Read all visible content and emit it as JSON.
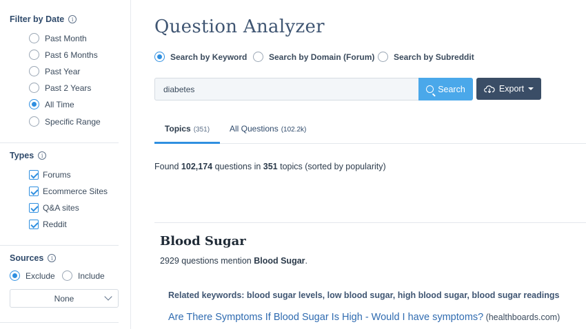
{
  "sidebar": {
    "filter_by_date": {
      "title": "Filter by Date",
      "options": [
        "Past Month",
        "Past 6 Months",
        "Past Year",
        "Past 2 Years",
        "All Time",
        "Specific Range"
      ],
      "selected": "All Time"
    },
    "types": {
      "title": "Types",
      "options": [
        "Forums",
        "Ecommerce Sites",
        "Q&A sites",
        "Reddit"
      ],
      "checked": [
        true,
        true,
        true,
        true
      ]
    },
    "sources": {
      "title": "Sources",
      "exclude_label": "Exclude",
      "include_label": "Include",
      "selected": "Exclude",
      "select_value": "None"
    }
  },
  "main": {
    "title": "Question Analyzer",
    "search_modes": [
      "Search by Keyword",
      "Search by Domain (Forum)",
      "Search by Subreddit"
    ],
    "selected_mode": "Search by Keyword",
    "search_value": "diabetes",
    "search_button": "Search",
    "export_button": "Export",
    "tabs": [
      {
        "label": "Topics",
        "count": "(351)"
      },
      {
        "label": "All Questions",
        "count": "(102.2k)"
      }
    ],
    "found": {
      "prefix": "Found ",
      "questions": "102,174",
      "middle": " questions in ",
      "topics": "351",
      "suffix": " topics (sorted by popularity)"
    },
    "topic": {
      "title": "Blood Sugar",
      "mention_prefix": "2929 questions mention ",
      "mention_term": "Blood Sugar",
      "mention_suffix": ".",
      "related": "Related keywords: blood sugar levels, low blood sugar, high blood sugar, blood sugar readings",
      "question": "Are There Symptoms If Blood Sugar Is High - Would I have symptoms?",
      "question_domain": "(healthboards.com)"
    }
  },
  "colors": {
    "accent": "#2f8fe0",
    "search_button": "#4aa8ea",
    "export_button": "#3a4d66",
    "link": "#2f6bb0"
  }
}
